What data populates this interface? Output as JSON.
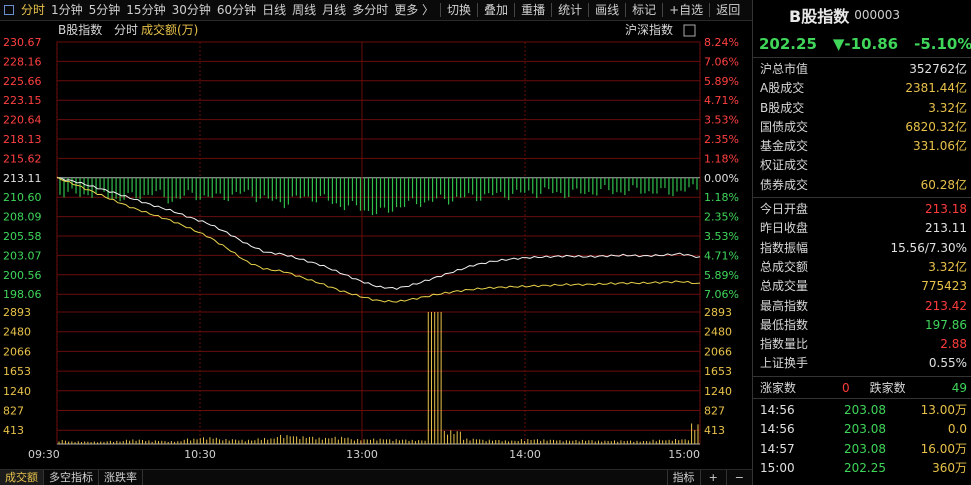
{
  "toolbar": {
    "tabs": [
      "分时",
      "1分钟",
      "5分钟",
      "15分钟",
      "30分钟",
      "60分钟",
      "日线",
      "周线",
      "月线",
      "多分时",
      "更多 〉"
    ],
    "active_tab": "分时",
    "actions": [
      "切换",
      "叠加",
      "重播",
      "统计",
      "画线",
      "标记",
      "+自选",
      "返回"
    ]
  },
  "chart_header": {
    "index_name": "B股指数",
    "mode": "分时",
    "metric": "成交额(万)",
    "compare": "沪深指数"
  },
  "price_axis": {
    "left": [
      "230.67",
      "228.16",
      "225.66",
      "223.15",
      "220.64",
      "218.13",
      "215.62",
      "213.11",
      "210.60",
      "208.09",
      "205.58",
      "203.07",
      "200.56",
      "198.06"
    ],
    "right": [
      "8.24%",
      "7.06%",
      "5.89%",
      "4.71%",
      "3.53%",
      "2.35%",
      "1.18%",
      "0.00%",
      "1.18%",
      "2.35%",
      "3.53%",
      "4.71%",
      "5.89%",
      "7.06%"
    ]
  },
  "volume_axis": [
    "2893",
    "2480",
    "2066",
    "1653",
    "1240",
    "827",
    "413"
  ],
  "time_axis": [
    "09:30",
    "10:30",
    "13:00",
    "14:00",
    "15:00"
  ],
  "bottom_tabs": [
    "成交额",
    "多空指标",
    "涨跌率"
  ],
  "bottom_right": [
    "指标",
    "+",
    "−"
  ],
  "quote": {
    "name": "B股指数",
    "code": "000003",
    "price": "202.25",
    "change": "▼-10.86",
    "change_pct": "-5.10%"
  },
  "stats_group1": [
    {
      "label": "沪总市值",
      "value": "352762亿",
      "color": "w"
    },
    {
      "label": "A股成交",
      "value": "2381.44亿",
      "color": "y"
    },
    {
      "label": "B股成交",
      "value": "3.32亿",
      "color": "y"
    },
    {
      "label": "国债成交",
      "value": "6820.32亿",
      "color": "y"
    },
    {
      "label": "基金成交",
      "value": "331.06亿",
      "color": "y"
    },
    {
      "label": "权证成交",
      "value": "",
      "color": "y"
    },
    {
      "label": "债券成交",
      "value": "60.28亿",
      "color": "y"
    }
  ],
  "stats_group2": [
    {
      "label": "今日开盘",
      "value": "213.18",
      "color": "r"
    },
    {
      "label": "昨日收盘",
      "value": "213.11",
      "color": "w"
    },
    {
      "label": "指数振幅",
      "value": "15.56/7.30%",
      "color": "w"
    },
    {
      "label": "总成交额",
      "value": "3.32亿",
      "color": "y"
    },
    {
      "label": "总成交量",
      "value": "775423",
      "color": "y"
    },
    {
      "label": "最高指数",
      "value": "213.42",
      "color": "r"
    },
    {
      "label": "最低指数",
      "value": "197.86",
      "color": "g"
    },
    {
      "label": "指数量比",
      "value": "2.88",
      "color": "r"
    },
    {
      "label": "上证换手",
      "value": "0.55%",
      "color": "w"
    }
  ],
  "breadth": {
    "up_label": "涨家数",
    "up": "0",
    "down_label": "跌家数",
    "down": "49"
  },
  "trades": [
    {
      "time": "14:56",
      "price": "203.08",
      "amount": "13.00万"
    },
    {
      "time": "14:56",
      "price": "203.08",
      "amount": "0.0"
    },
    {
      "time": "14:57",
      "price": "203.08",
      "amount": "16.00万"
    },
    {
      "time": "15:00",
      "price": "202.25",
      "amount": "360万"
    }
  ],
  "chart_data": {
    "type": "line",
    "x_ticks": [
      "09:30",
      "10:30",
      "13:00",
      "14:00",
      "15:00"
    ],
    "prev_close": 213.11,
    "ylim": [
      198.06,
      230.67
    ],
    "series": [
      {
        "values": [
          213.11,
          212.6,
          211.9,
          211.2,
          210.4,
          209.6,
          208.9,
          208.0,
          207.2,
          206.0,
          204.6,
          203.5,
          203.2,
          202.5,
          201.8,
          200.8,
          199.8,
          199.0,
          198.8,
          199.4,
          200.2,
          201.0,
          201.8,
          202.3,
          202.6,
          202.8,
          202.9,
          203.0,
          202.9,
          203.0,
          203.1,
          203.0,
          203.1,
          203.3,
          202.8
        ]
      },
      {
        "values": [
          213.11,
          212.2,
          211.2,
          210.2,
          209.2,
          208.4,
          207.6,
          206.6,
          205.5,
          204.0,
          202.3,
          201.3,
          201.0,
          200.2,
          199.4,
          198.5,
          197.8,
          197.2,
          197.1,
          197.5,
          198.0,
          198.4,
          198.7,
          198.9,
          199.0,
          199.1,
          199.2,
          199.3,
          199.3,
          199.4,
          199.5,
          199.5,
          199.6,
          199.7,
          199.4
        ]
      }
    ],
    "ratio_bars": [
      -0.28,
      -0.35,
      -0.3,
      -0.42,
      -0.38,
      -0.3,
      -0.45,
      -0.33,
      -0.4,
      -0.36,
      -0.3,
      -0.44,
      -0.5,
      -0.38,
      -0.42,
      -0.55,
      -0.6,
      -0.72,
      -0.58,
      -0.5,
      -0.45,
      -0.42,
      -0.38,
      -0.35,
      -0.33,
      -0.3,
      -0.28,
      -0.32,
      -0.3,
      -0.26,
      -0.28,
      -0.25,
      -0.3,
      -0.27,
      -0.22
    ],
    "volume_max": 2893,
    "volume": [
      90,
      60,
      55,
      70,
      100,
      80,
      65,
      120,
      150,
      110,
      95,
      130,
      200,
      170,
      140,
      160,
      110,
      120,
      105,
      90,
      2893,
      300,
      120,
      95,
      80,
      110,
      100,
      85,
      90,
      75,
      80,
      70,
      95,
      110,
      450
    ]
  }
}
